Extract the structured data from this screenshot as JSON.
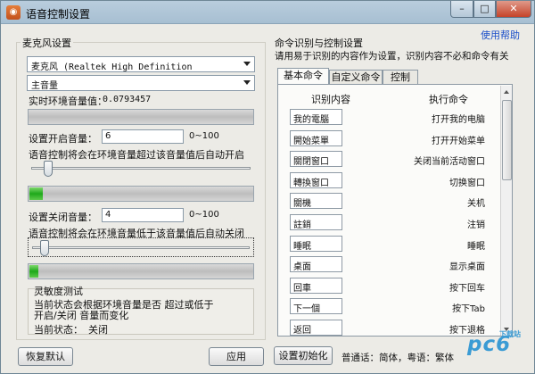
{
  "window": {
    "title": "语音控制设置",
    "min": "–",
    "max": "□",
    "close": "✕"
  },
  "left": {
    "group_title": "麦克风设置",
    "device_select": "麦克风 (Realtek High Definition",
    "volume_select": "主音量",
    "ambient_label": "实时环境音量值：",
    "ambient_value": "0.0793457",
    "open_label": "设置开启音量：",
    "open_value": "6",
    "open_range": "0~100",
    "open_desc": "语音控制将会在环境音量超过该音量值后自动开启",
    "open_slider_percent": 6,
    "open_level_percent": 6,
    "close_label": "设置关闭音量：",
    "close_value": "4",
    "close_range": "0~100",
    "close_desc": "语音控制将会在环境音量低于该音量值后自动关闭",
    "close_slider_percent": 4,
    "close_level_percent": 4,
    "sens_title": "灵敏度测试",
    "sens_desc_1": "当前状态会根据环境音量是否 超过或低于",
    "sens_desc_2": "开启/关闭 音量而变化",
    "status_label": "当前状态：",
    "status_value": "关闭",
    "reset_button": "恢复默认",
    "apply_button": "应用"
  },
  "right": {
    "group_title": "命令识别与控制设置",
    "help_link": "使用帮助",
    "desc": "请用易于识别的内容作为设置，识别内容不必和命令有关",
    "tabs": [
      "基本命令",
      "自定义命令",
      "控制"
    ],
    "col_recognize": "识别内容",
    "col_command": "执行命令",
    "rows": [
      {
        "in": "我的電腦",
        "cmd": "打开我的电脑"
      },
      {
        "in": "開始菜單",
        "cmd": "打开开始菜单"
      },
      {
        "in": "關閉窗口",
        "cmd": "关闭当前活动窗口"
      },
      {
        "in": "轉換窗口",
        "cmd": "切换窗口"
      },
      {
        "in": "關機",
        "cmd": "关机"
      },
      {
        "in": "註銷",
        "cmd": "注销"
      },
      {
        "in": "睡眠",
        "cmd": "睡眠"
      },
      {
        "in": "桌面",
        "cmd": "显示桌面"
      },
      {
        "in": "回車",
        "cmd": "按下回车"
      },
      {
        "in": "下一個",
        "cmd": "按下Tab"
      },
      {
        "in": "返回",
        "cmd": "按下退格"
      }
    ],
    "init_button": "设置初始化",
    "footer": "普通话：简体，粤语：繁体"
  },
  "watermark": {
    "brand": "pc6",
    "sub": "下载站"
  },
  "colors": {
    "level_green": "#1ea81a",
    "link": "#1c4fc9",
    "title_bar": "#a7bfd2"
  }
}
